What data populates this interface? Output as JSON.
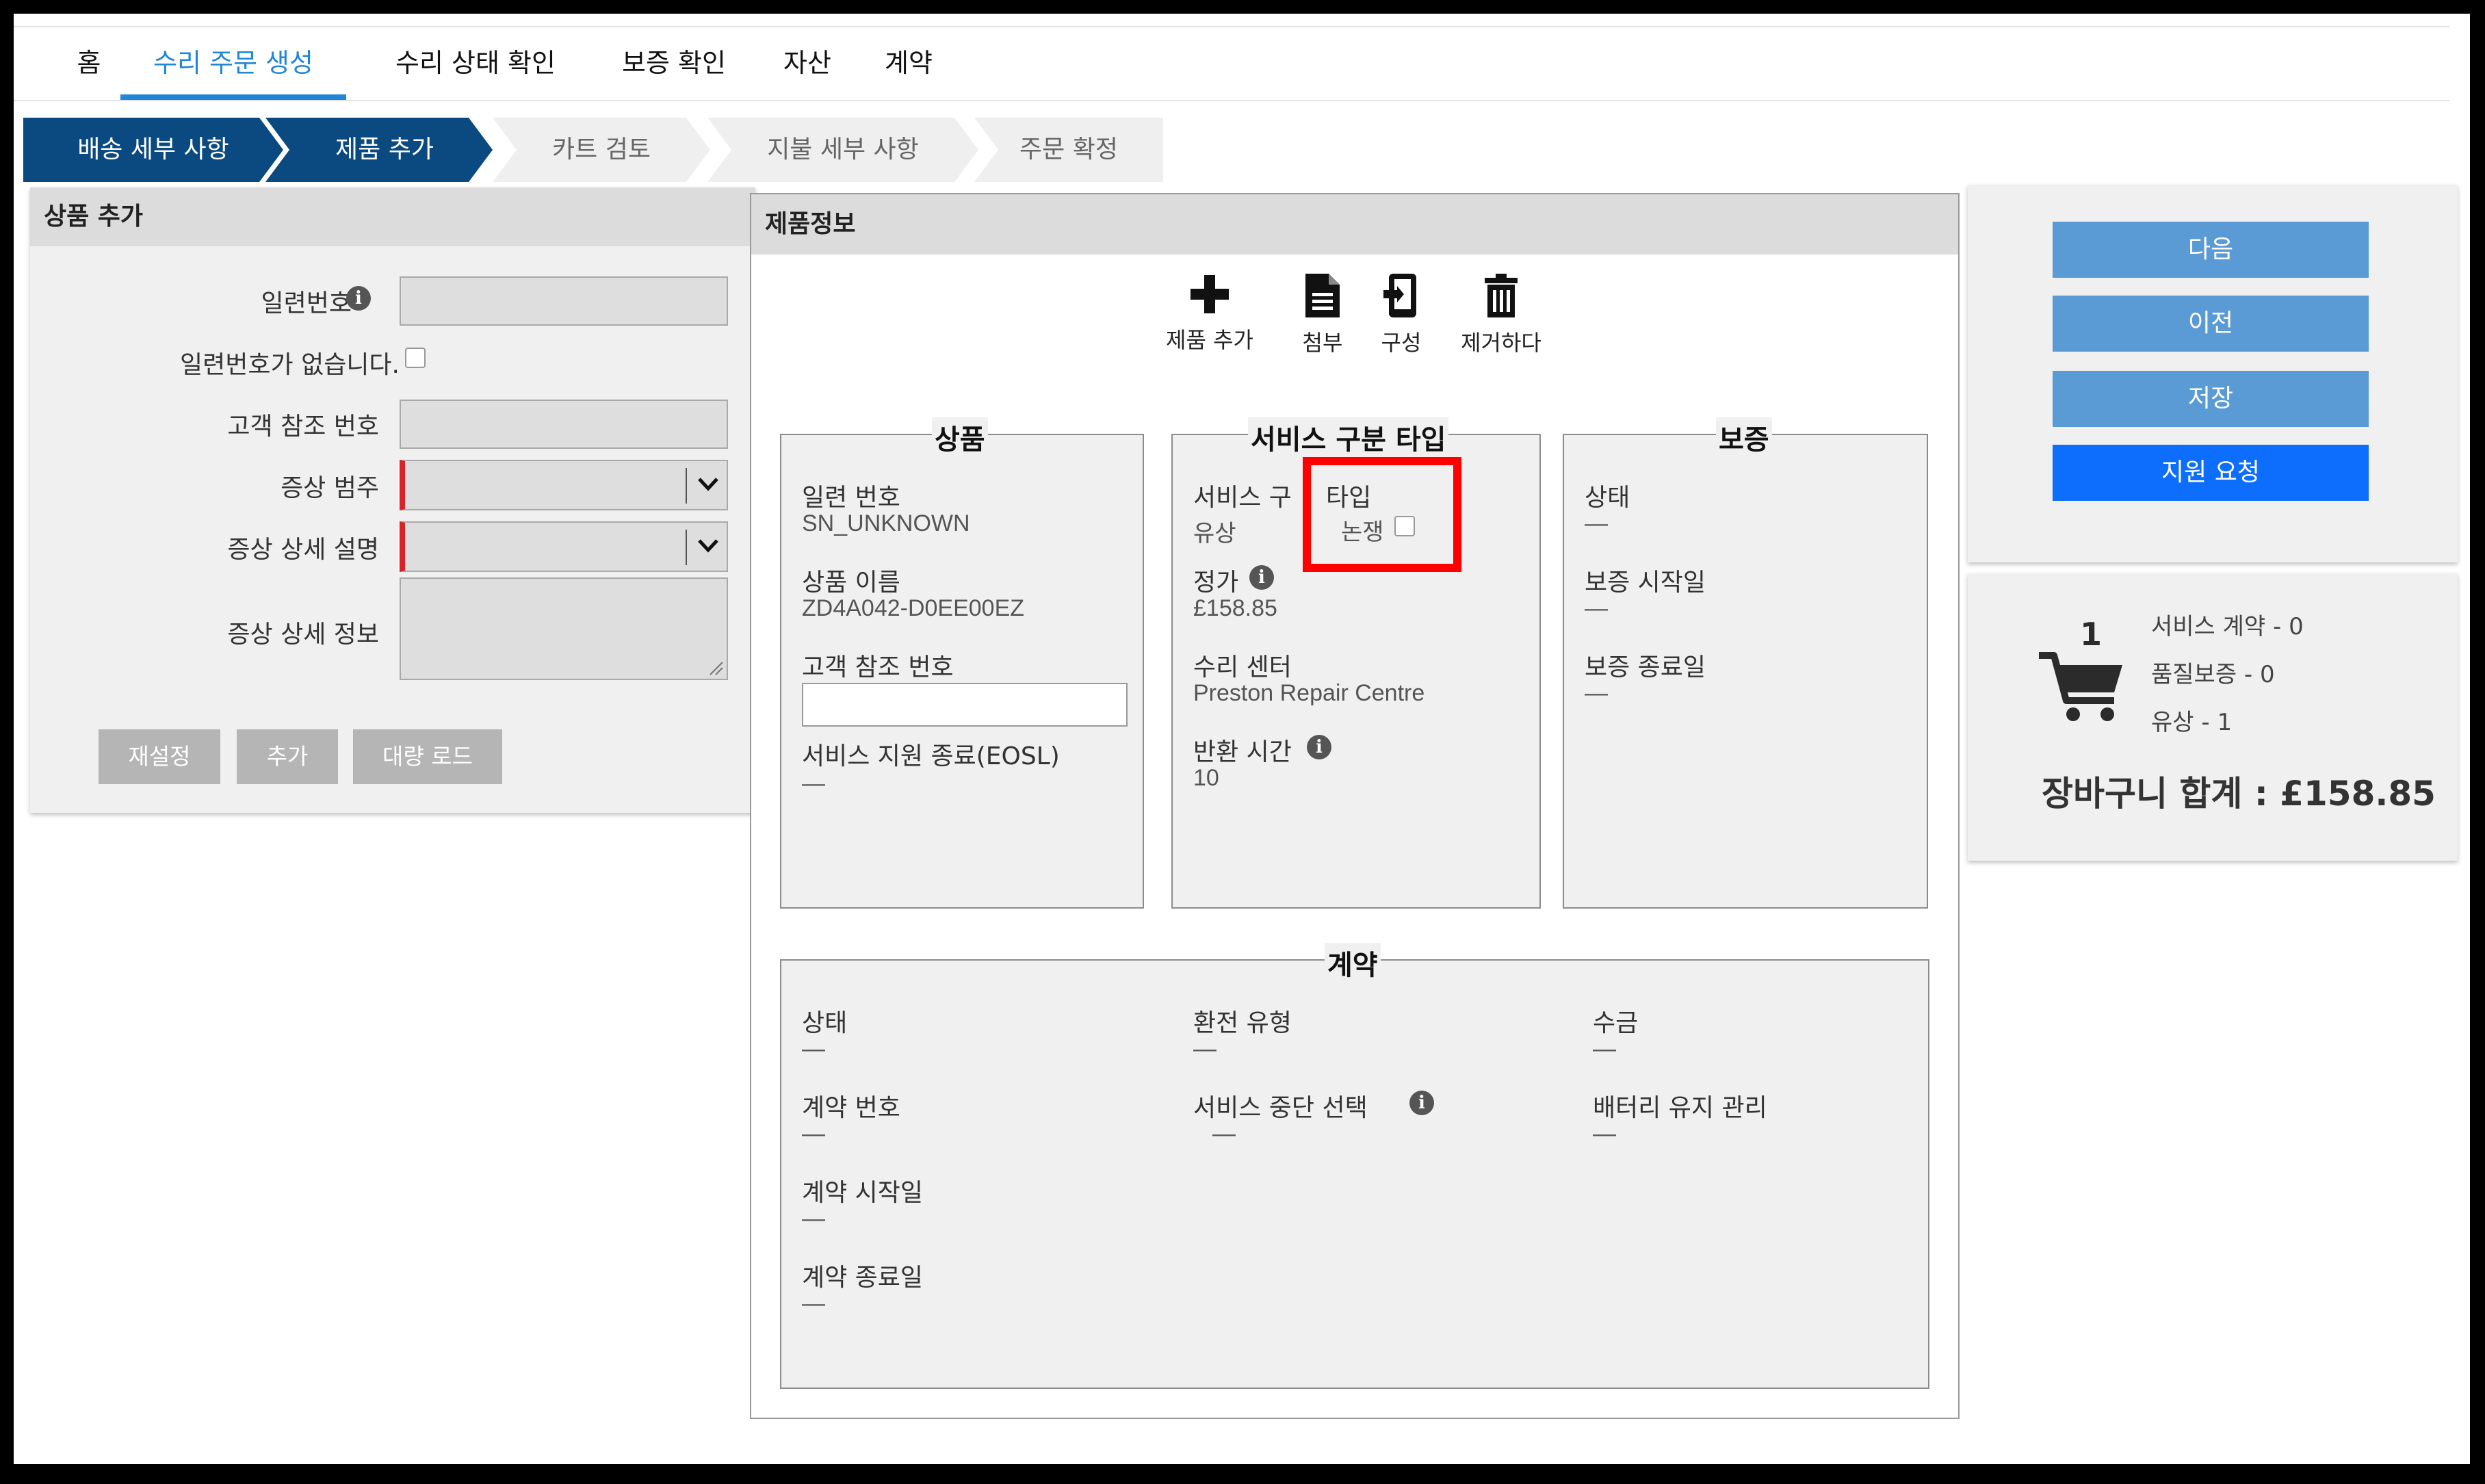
{
  "nav": {
    "tabs": [
      "홈",
      "수리 주문 생성",
      "수리 상태 확인",
      "보증 확인",
      "자산",
      "계약"
    ],
    "active": 1
  },
  "steps": [
    "배송 세부 사항",
    "제품 추가",
    "카트 검토",
    "지불 세부 사항",
    "주문 확정"
  ],
  "add_product": {
    "title": "상품 추가",
    "serial_label": "일련번호",
    "no_serial_label": "일련번호가 없습니다.",
    "customer_ref_label": "고객 참조 번호",
    "symptom_category_label": "증상 범주",
    "symptom_detail_label": "증상 상세 설명",
    "symptom_info_label": "증상 상세 정보",
    "reset_button": "재설정",
    "add_button": "추가",
    "bulk_load_button": "대량 로드"
  },
  "product_info": {
    "title": "제품정보",
    "toolbar": {
      "add": "제품 추가",
      "attach": "첨부",
      "configure": "구성",
      "remove": "제거하다"
    },
    "product": {
      "legend": "상품",
      "serial_label": "일련 번호",
      "serial_value": "SN_UNKNOWN",
      "name_label": "상품 이름",
      "name_value": "ZD4A042-D0EE00EZ",
      "customer_ref_label": "고객 참조 번호",
      "eosl_label": "서비스 지원 종료(EOSL)",
      "eosl_value": "—"
    },
    "service": {
      "legend": "서비스 구분 타입",
      "type_label_a": "서비스 구",
      "type_label_b": "타입",
      "type_value": "유상",
      "dispute_label": "논쟁",
      "price_label": "정가",
      "price_value": "£158.85",
      "center_label": "수리 센터",
      "center_value": "Preston Repair Centre",
      "return_label": "반환 시간",
      "return_value": "10"
    },
    "warranty": {
      "legend": "보증",
      "status_label": "상태",
      "status_value": "—",
      "start_label": "보증 시작일",
      "start_value": "—",
      "end_label": "보증 종료일",
      "end_value": "—"
    },
    "contract": {
      "legend": "계약",
      "status_label": "상태",
      "status_value": "—",
      "number_label": "계약 번호",
      "number_value": "—",
      "start_label": "계약 시작일",
      "start_value": "—",
      "end_label": "계약 종료일",
      "end_value": "—",
      "refund_label": "환전 유형",
      "refund_value": "—",
      "interrupt_label": "서비스 중단 선택",
      "interrupt_value": "—",
      "collect_label": "수금",
      "collect_value": "—",
      "battery_label": "배터리 유지 관리",
      "battery_value": "—"
    }
  },
  "actions": {
    "next": "다음",
    "prev": "이전",
    "save": "저장",
    "support": "지원 요청"
  },
  "cart": {
    "count": "1",
    "service_contract": "서비스 계약 - 0",
    "warranty": "품질보증 - 0",
    "paid": "유상 - 1",
    "total": "장바구니 합계 : £158.85"
  },
  "colors": {
    "step_done": "#0a4a80",
    "step_todo": "#efefef",
    "nav_active": "#1f86d8",
    "highlight": "#ff0000",
    "action_button": "#5b9bd5",
    "support_button": "#0d6efd"
  }
}
